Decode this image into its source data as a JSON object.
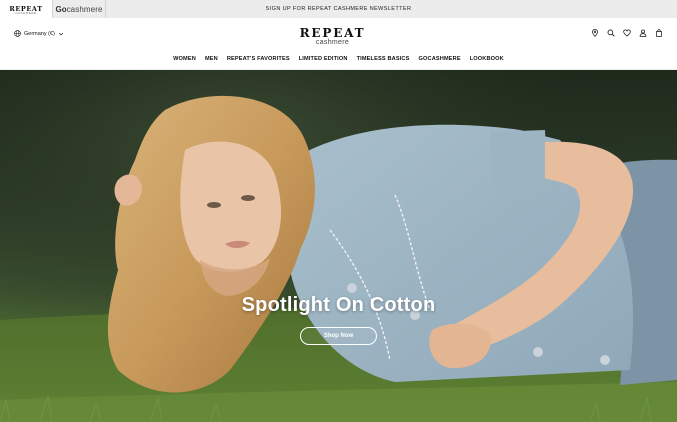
{
  "topbar": {
    "brand_repeat": "REPEAT",
    "brand_repeat_sub": "CASHMERE",
    "brand_go_prefix": "Go",
    "brand_go_suffix": "cashmere",
    "newsletter": "SIGN UP FOR REPEAT CASHMERE NEWSLETTER",
    "background": "#ececec"
  },
  "header": {
    "locale": "Germany (€)",
    "logo_main": "REPEAT",
    "logo_sub": "cashmere",
    "icons": [
      "location-pin-icon",
      "search-icon",
      "heart-icon",
      "user-icon",
      "bag-icon"
    ]
  },
  "nav": {
    "items": [
      {
        "label": "WOMEN"
      },
      {
        "label": "MEN"
      },
      {
        "label": "REPEAT'S FAVORITES"
      },
      {
        "label": "LIMITED EDITION"
      },
      {
        "label": "TIMELESS BASICS"
      },
      {
        "label": "GOCASHMERE"
      },
      {
        "label": "LOOKBOOK"
      }
    ]
  },
  "hero": {
    "title": "Spotlight On Cotton",
    "button": "Shop Now"
  }
}
